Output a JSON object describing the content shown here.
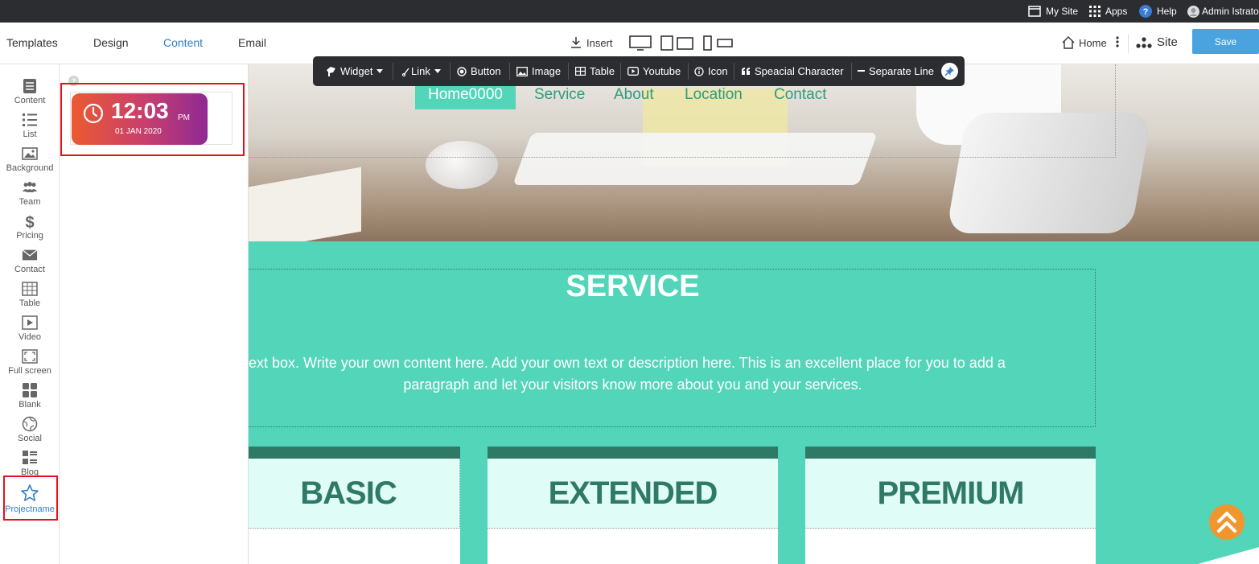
{
  "topbar": {
    "my_site": "My Site",
    "apps": "Apps",
    "help": "Help",
    "user": "Admin Istrato"
  },
  "toolbar": {
    "tabs": [
      "Templates",
      "Design",
      "Content",
      "Email"
    ],
    "active_tab": "Content",
    "insert": "Insert",
    "home": "Home",
    "site": "Site",
    "save": "Save"
  },
  "rail": {
    "items": [
      {
        "label": "Content",
        "icon": "content-icon"
      },
      {
        "label": "List",
        "icon": "list-icon"
      },
      {
        "label": "Background",
        "icon": "image-icon"
      },
      {
        "label": "Team",
        "icon": "team-icon"
      },
      {
        "label": "Pricing",
        "icon": "dollar-icon"
      },
      {
        "label": "Contact",
        "icon": "envelope-icon"
      },
      {
        "label": "Table",
        "icon": "table-icon"
      },
      {
        "label": "Video",
        "icon": "play-icon"
      },
      {
        "label": "Full screen",
        "icon": "fullscreen-icon"
      },
      {
        "label": "Blank",
        "icon": "grid-icon"
      },
      {
        "label": "Social",
        "icon": "globe-icon"
      },
      {
        "label": "Blog",
        "icon": "blog-icon"
      },
      {
        "label": "Projectname",
        "icon": "star-icon"
      }
    ],
    "active": "Projectname"
  },
  "panel": {
    "help_icon": "question-icon",
    "clock": {
      "time": "12:03",
      "ampm": "PM",
      "date": "01 JAN 2020"
    }
  },
  "floatbar": {
    "widget": "Widget",
    "link": "Link",
    "button": "Button",
    "image": "Image",
    "table": "Table",
    "youtube": "Youtube",
    "icon": "Icon",
    "special": "Speacial Character",
    "separator": "Separate Line"
  },
  "page": {
    "nav": [
      "Home0000",
      "Service",
      "About",
      "Location",
      "Contact"
    ],
    "service_title": "SERVICE",
    "service_text_1": "ext box. Write your own content here. Add your own text or description here. This is an excellent place for you to add a",
    "service_text_2": "paragraph and let your visitors know more about you and your services.",
    "plans": [
      "BASIC",
      "EXTENDED",
      "PREMIUM"
    ]
  },
  "colors": {
    "accent": "#2f7ec6",
    "teal": "#52d5b9",
    "dark_teal": "#2f7a66",
    "save": "#4aa3df",
    "highlight": "#e5101d",
    "fab": "#f1962f"
  }
}
